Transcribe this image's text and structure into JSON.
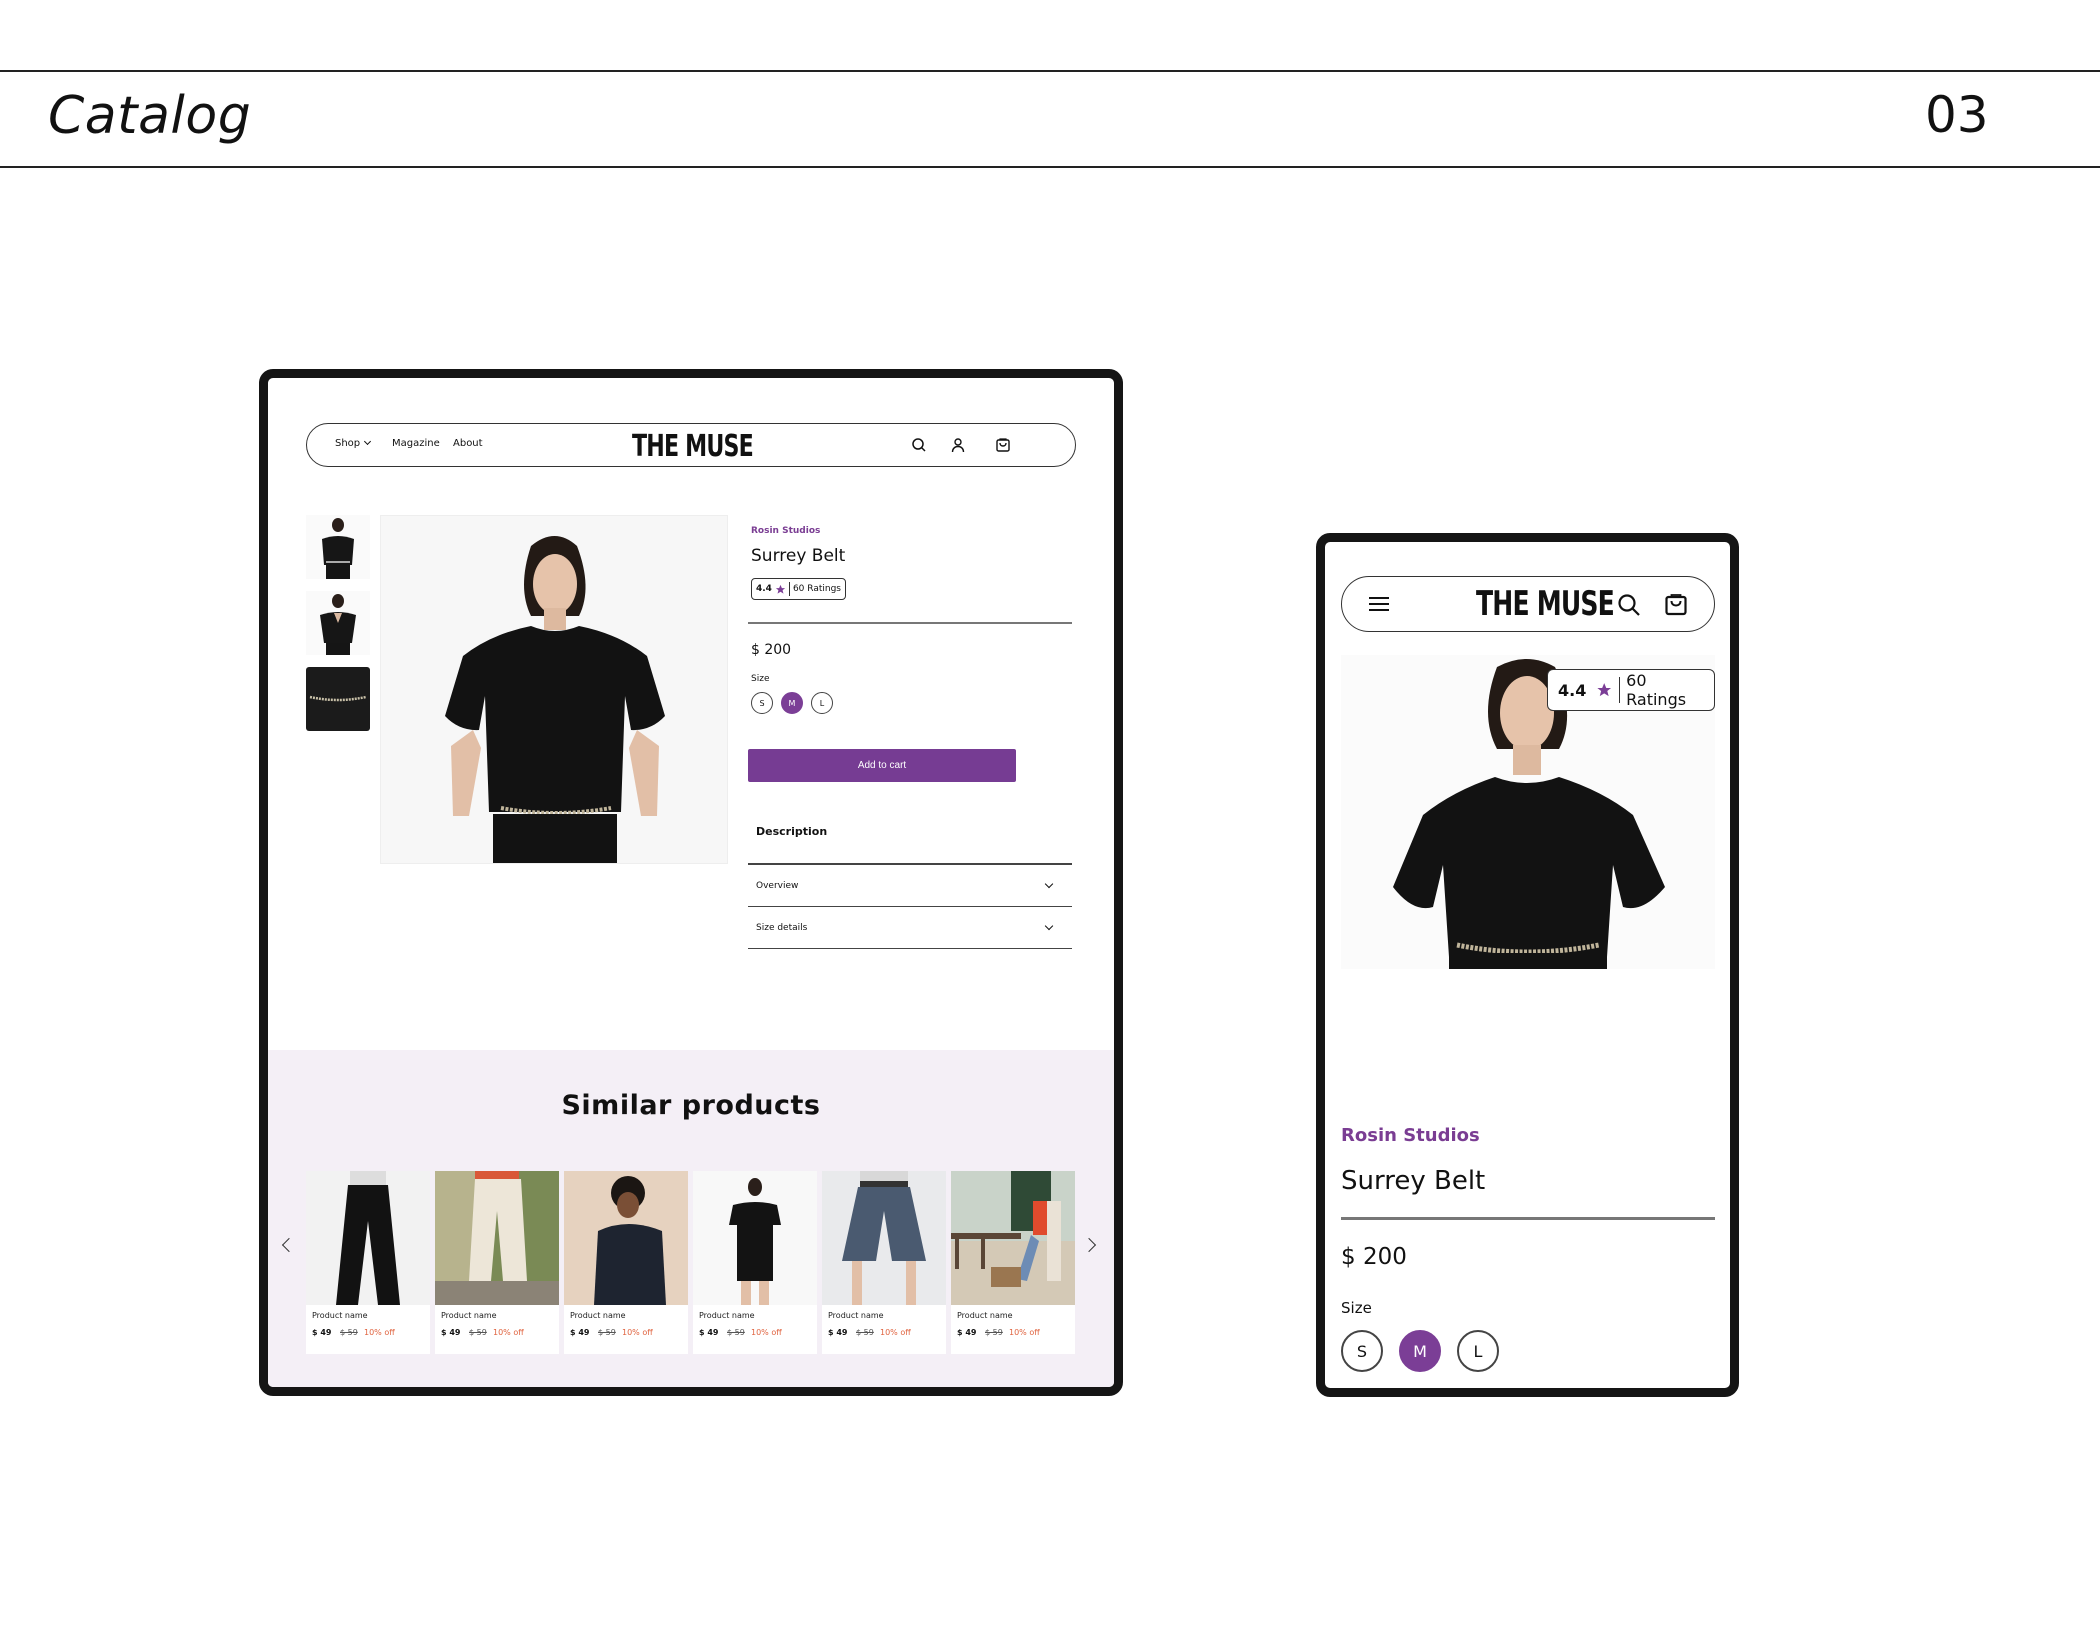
{
  "slide": {
    "title": "Catalog",
    "number": "03"
  },
  "desktop": {
    "nav": {
      "shop": "Shop",
      "magazine": "Magazine",
      "about": "About",
      "logo": "THE MUSE"
    },
    "product": {
      "brand": "Rosin Studios",
      "name": "Surrey Belt",
      "rating": "4.4",
      "ratings_count": "60 Ratings",
      "price": "$ 200",
      "size_label": "Size",
      "sizes": [
        "S",
        "M",
        "L"
      ],
      "selected_size": "M",
      "add_to_cart": "Add to cart",
      "description_label": "Description",
      "accordions": [
        "Overview",
        "Size details"
      ]
    },
    "similar": {
      "title": "Similar products",
      "cards": [
        {
          "name": "Product name",
          "price": "$ 49",
          "old_price": "$ 59",
          "discount": "10% off"
        },
        {
          "name": "Product name",
          "price": "$ 49",
          "old_price": "$ 59",
          "discount": "10% off"
        },
        {
          "name": "Product name",
          "price": "$ 49",
          "old_price": "$ 59",
          "discount": "10% off"
        },
        {
          "name": "Product name",
          "price": "$ 49",
          "old_price": "$ 59",
          "discount": "10% off"
        },
        {
          "name": "Product name",
          "price": "$ 49",
          "old_price": "$ 59",
          "discount": "10% off"
        },
        {
          "name": "Product name",
          "price": "$ 49",
          "old_price": "$ 59",
          "discount": "10% off"
        }
      ]
    }
  },
  "mobile": {
    "logo": "THE MUSE",
    "rating": "4.4",
    "ratings_count": "60 Ratings",
    "brand": "Rosin Studios",
    "name": "Surrey Belt",
    "price": "$ 200",
    "size_label": "Size",
    "sizes": [
      "S",
      "M",
      "L"
    ],
    "selected_size": "M",
    "carousel_pages": 4,
    "carousel_active": 1
  },
  "colors": {
    "accent": "#763c93",
    "discount": "#e0633f",
    "similar_bg": "#f4eff6"
  }
}
